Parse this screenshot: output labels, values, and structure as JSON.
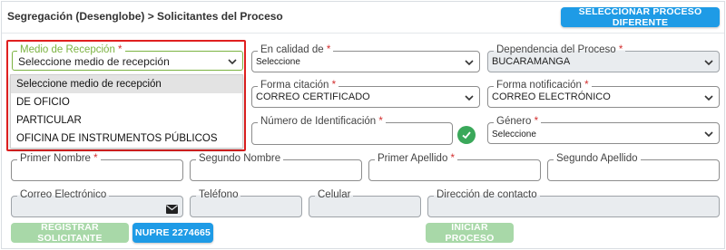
{
  "header": {
    "title": "Segregación (Desenglobe) > Solicitantes del Proceso",
    "select_other_button": "SELECCIONAR PROCESO DIFERENTE"
  },
  "form": {
    "medio_recepcion": {
      "label": "Medio de Recepción",
      "required": "*",
      "value": "Seleccione medio de recepción",
      "options": [
        "Seleccione medio de recepción",
        "DE OFICIO",
        "PARTICULAR",
        "OFICINA DE INSTRUMENTOS PÚBLICOS"
      ]
    },
    "en_calidad_de": {
      "label": "En calidad de",
      "required": "*",
      "value": "Seleccione"
    },
    "dependencia": {
      "label": "Dependencia del Proceso",
      "required": "*",
      "value": "BUCARAMANGA"
    },
    "forma_citacion": {
      "label": "Forma citación",
      "required": "*",
      "value": "CORREO CERTIFICADO"
    },
    "forma_notificacion": {
      "label": "Forma notificación",
      "required": "*",
      "value": "CORREO ELECTRÓNICO"
    },
    "numero_identificacion": {
      "label": "Número de Identificación",
      "required": "*",
      "value": ""
    },
    "genero": {
      "label": "Género",
      "required": "*",
      "value": "Seleccione"
    },
    "primer_nombre": {
      "label": "Primer Nombre",
      "required": "*",
      "value": ""
    },
    "segundo_nombre": {
      "label": "Segundo Nombre",
      "value": ""
    },
    "primer_apellido": {
      "label": "Primer Apellido",
      "required": "*",
      "value": ""
    },
    "segundo_apellido": {
      "label": "Segundo Apellido",
      "value": ""
    },
    "correo": {
      "label": "Correo Electrónico",
      "value": ""
    },
    "telefono": {
      "label": "Teléfono",
      "value": ""
    },
    "celular": {
      "label": "Celular",
      "value": ""
    },
    "direccion": {
      "label": "Dirección de contacto",
      "value": ""
    }
  },
  "actions": {
    "registrar": "REGISTRAR SOLICITANTE",
    "nupre": "NUPRE 2274665",
    "iniciar": "INICIAR PROCESO"
  },
  "colors": {
    "accent_blue": "#1e9be6",
    "disabled_green": "#a8d8a8",
    "highlight_red": "#e02020",
    "focus_green": "#7cb342",
    "check_green": "#3aa85a"
  },
  "icons": {
    "select_chevron": "chevron-down-icon",
    "id_status": "check-circle-icon",
    "email": "envelope-icon"
  }
}
